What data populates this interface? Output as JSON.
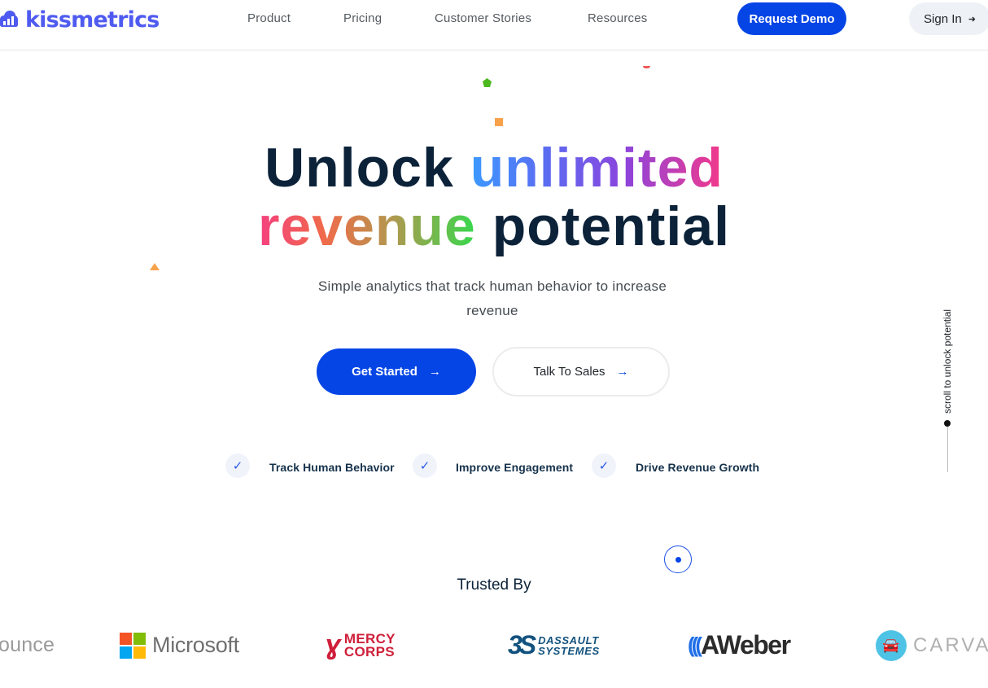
{
  "header": {
    "brand": "kissmetrics",
    "brand_color": "#4f5bf0",
    "nav": [
      {
        "label": "Product"
      },
      {
        "label": "Pricing"
      },
      {
        "label": "Customer Stories"
      },
      {
        "label": "Resources"
      }
    ],
    "request_demo_label": "Request Demo",
    "sign_in_label": "Sign In",
    "sign_in_icon": "sign-in-icon",
    "accent_color": "#0545e6"
  },
  "hero": {
    "title_part1": "Unlock",
    "title_highlight1": "unlimited",
    "title_highlight2": "revenue",
    "title_part2": "potential",
    "subtitle": "Simple analytics that track human behavior to increase revenue",
    "get_started_label": "Get Started",
    "get_started_icon": "arrow-right-icon",
    "talk_to_sales_label": "Talk To Sales",
    "talk_to_sales_icon": "arrow-right-icon",
    "features": [
      {
        "label": "Track Human Behavior",
        "icon": "check-icon"
      },
      {
        "label": "Improve Engagement",
        "icon": "check-icon"
      },
      {
        "label": "Drive Revenue Growth",
        "icon": "check-icon"
      }
    ]
  },
  "scroll_indicator": {
    "label": "scroll to unlock potential"
  },
  "trusted": {
    "title": "Trusted By",
    "logos": [
      {
        "name": "Unbounce",
        "visible_text": "ounce"
      },
      {
        "name": "Microsoft",
        "visible_text": "Microsoft"
      },
      {
        "name": "Mercy Corps",
        "line1": "MERCY",
        "line2": "CORPS"
      },
      {
        "name": "Dassault Systemes",
        "line1": "DASSAULT",
        "line2": "SYSTEMES"
      },
      {
        "name": "AWeber",
        "visible_text": "AWeber"
      },
      {
        "name": "Carvana",
        "visible_text": "CARVAN"
      }
    ]
  }
}
